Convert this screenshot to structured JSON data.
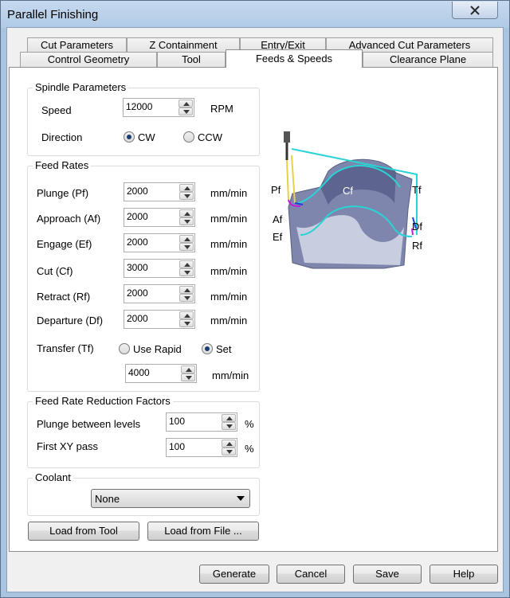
{
  "window": {
    "title": "Parallel Finishing"
  },
  "tabs": {
    "row1": [
      "Cut Parameters",
      "Z Containment",
      "Entry/Exit",
      "Advanced Cut Parameters"
    ],
    "row2": [
      "Control Geometry",
      "Tool",
      "Feeds & Speeds",
      "Clearance Plane"
    ],
    "active": "Feeds & Speeds"
  },
  "spindle": {
    "title": "Spindle Parameters",
    "speed_label": "Speed",
    "speed_value": "12000",
    "speed_unit": "RPM",
    "direction_label": "Direction",
    "cw_label": "CW",
    "ccw_label": "CCW",
    "direction_selected": "CW"
  },
  "feed_rates": {
    "title": "Feed Rates",
    "unit": "mm/min",
    "rows": [
      {
        "label": "Plunge (Pf)",
        "value": "2000"
      },
      {
        "label": "Approach (Af)",
        "value": "2000"
      },
      {
        "label": "Engage (Ef)",
        "value": "2000"
      },
      {
        "label": "Cut (Cf)",
        "value": "3000"
      },
      {
        "label": "Retract (Rf)",
        "value": "2000"
      },
      {
        "label": "Departure  (Df)",
        "value": "2000"
      }
    ],
    "transfer_label": "Transfer (Tf)",
    "use_rapid_label": "Use Rapid",
    "set_label": "Set",
    "transfer_selected": "Set",
    "transfer_value": "4000"
  },
  "reduction": {
    "title": "Feed Rate Reduction Factors",
    "unit": "%",
    "plunge_label": "Plunge between levels",
    "plunge_value": "100",
    "first_xy_label": "First XY pass",
    "first_xy_value": "100"
  },
  "coolant": {
    "title": "Coolant",
    "selected": "None"
  },
  "load_buttons": {
    "from_tool": "Load from Tool",
    "from_file": "Load from File ..."
  },
  "diagram_labels": {
    "pf": "Pf",
    "af": "Af",
    "ef": "Ef",
    "cf": "Cf",
    "tf": "Tf",
    "df": "Df",
    "rf": "Rf"
  },
  "footer": {
    "generate": "Generate",
    "cancel": "Cancel",
    "save": "Save",
    "help": "Help"
  },
  "colors": {
    "titlebar": "#b1cae6",
    "transfer_path": "#2ad4d4",
    "plunge_path": "#e6d24a",
    "approach_path": "#c21ad6",
    "engage_path": "#1f3fd6",
    "part": "#7e86ad"
  }
}
